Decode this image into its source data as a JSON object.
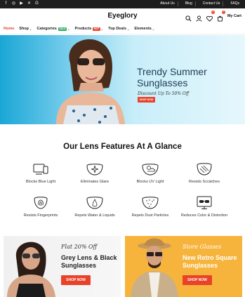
{
  "topbar": {
    "social": [
      "facebook-icon",
      "instagram-icon",
      "youtube-icon",
      "x-icon",
      "google-icon"
    ],
    "links": [
      "About Us",
      "Blog",
      "Contact Us",
      "FAQs"
    ]
  },
  "header": {
    "logo": "Eyeglory",
    "cart_label": "My Cart",
    "wishlist_count": "0",
    "cart_count": "0"
  },
  "nav": {
    "items": [
      {
        "label": "Home",
        "active": true
      },
      {
        "label": "Shop",
        "dropdown": true
      },
      {
        "label": "Categories",
        "dropdown": true,
        "tag": "SALE",
        "tag_color": "#2fae63"
      },
      {
        "label": "Products",
        "dropdown": true,
        "tag": "HOT",
        "tag_color": "#e8432a"
      },
      {
        "label": "Top Deals",
        "dropdown": true
      },
      {
        "label": "Elements",
        "dropdown": true
      }
    ]
  },
  "hero": {
    "kicker": "Discount Up To 50% Off",
    "title": "Trendy Summer Sunglasses",
    "button": "SHOP NOW"
  },
  "features": {
    "title": "Our Lens Features At A Glance",
    "items": [
      {
        "label": "Blocks Blue Light",
        "icon": "devices-icon"
      },
      {
        "label": "Eliminates Glare",
        "icon": "sparkle-lens-icon"
      },
      {
        "label": "Blocks UV Light",
        "icon": "sun-cloud-lens-icon"
      },
      {
        "label": "Resists Scratches",
        "icon": "scratch-lens-icon"
      },
      {
        "label": "Resists Fingerprints",
        "icon": "fingerprint-icon"
      },
      {
        "label": "Repels Water & Liquids",
        "icon": "water-drop-icon"
      },
      {
        "label": "Repels Dust Particles",
        "icon": "dust-lens-icon"
      },
      {
        "label": "Reduces Color & Distortion",
        "icon": "monitor-glasses-icon"
      }
    ]
  },
  "promos": [
    {
      "kicker": "Flat 20% Off",
      "title": "Grey Lens & Black Sunglasses",
      "button": "SHOP NOW"
    },
    {
      "kicker": "Store Glasses",
      "title": "New Retro Square Sunglasses",
      "button": "SHOP NOW"
    }
  ],
  "colors": {
    "accent": "#e8432a",
    "dark": "#1e1e1e",
    "promo_yellow": "#f6b43c",
    "hero_title": "#1e3e54"
  }
}
